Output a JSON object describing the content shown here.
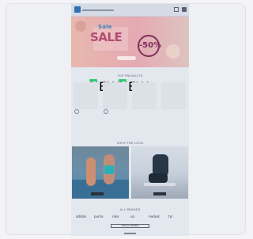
{
  "header": {
    "logo": "app-logo",
    "nav_text": "",
    "icons": [
      "bag-icon",
      "menu-icon"
    ]
  },
  "hero": {
    "kicker": "Sale",
    "title": "SALE",
    "subtitle": "",
    "discount": "-50%"
  },
  "sections": {
    "products_title": "TOP PRODUCTS",
    "lifestyle_title": "SHOP THE LOOK",
    "brands_title": "ALL BRANDS",
    "brands_button": "VIEW ALL BRANDS"
  },
  "products": [
    {
      "tag": "NEW",
      "name": "",
      "price": ""
    },
    {
      "tag": "NEW",
      "name": "",
      "price": ""
    },
    {
      "tag": "",
      "name": "",
      "price": ""
    },
    {
      "tag": "",
      "name": "",
      "price": ""
    }
  ],
  "photos": {
    "left_label": "",
    "right_label": ""
  },
  "brands": [
    "adidas",
    "puma",
    "nike",
    "ua",
    "reebok",
    "tyr"
  ],
  "colors": {
    "accent": "#2ecc71",
    "hero_pink": "#e5a9b2",
    "hero_blue": "#3c87b7"
  }
}
